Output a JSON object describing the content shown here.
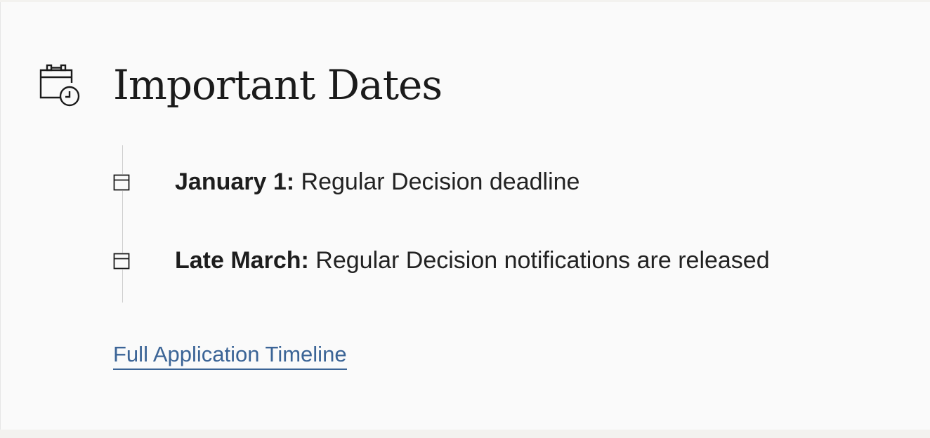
{
  "section": {
    "title": "Important Dates",
    "icon": "calendar-clock-icon"
  },
  "dates": [
    {
      "label": "January 1:",
      "description": "Regular Decision deadline"
    },
    {
      "label": "Late March:",
      "description": "Regular Decision notifications are released"
    }
  ],
  "link": {
    "label": "Full Application Timeline"
  },
  "colors": {
    "link": "#3b6496",
    "text": "#222222",
    "background": "#fafafa"
  }
}
